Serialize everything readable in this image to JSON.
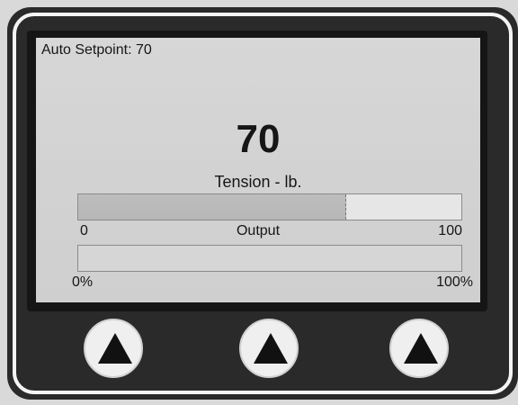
{
  "screen": {
    "auto_setpoint_text": "Auto Setpoint: 70",
    "main_value": "70",
    "main_label": "Tension - lb.",
    "tension_bar": {
      "min_label": "0",
      "center_label": "Output",
      "max_label": "100",
      "value": 70,
      "min": 0,
      "max": 100
    },
    "output_bar": {
      "min_label": "0%",
      "max_label": "100%",
      "value_percent": 0
    }
  },
  "buttons": [
    {
      "icon": "up-triangle-icon"
    },
    {
      "icon": "up-triangle-icon"
    },
    {
      "icon": "up-triangle-icon"
    }
  ]
}
